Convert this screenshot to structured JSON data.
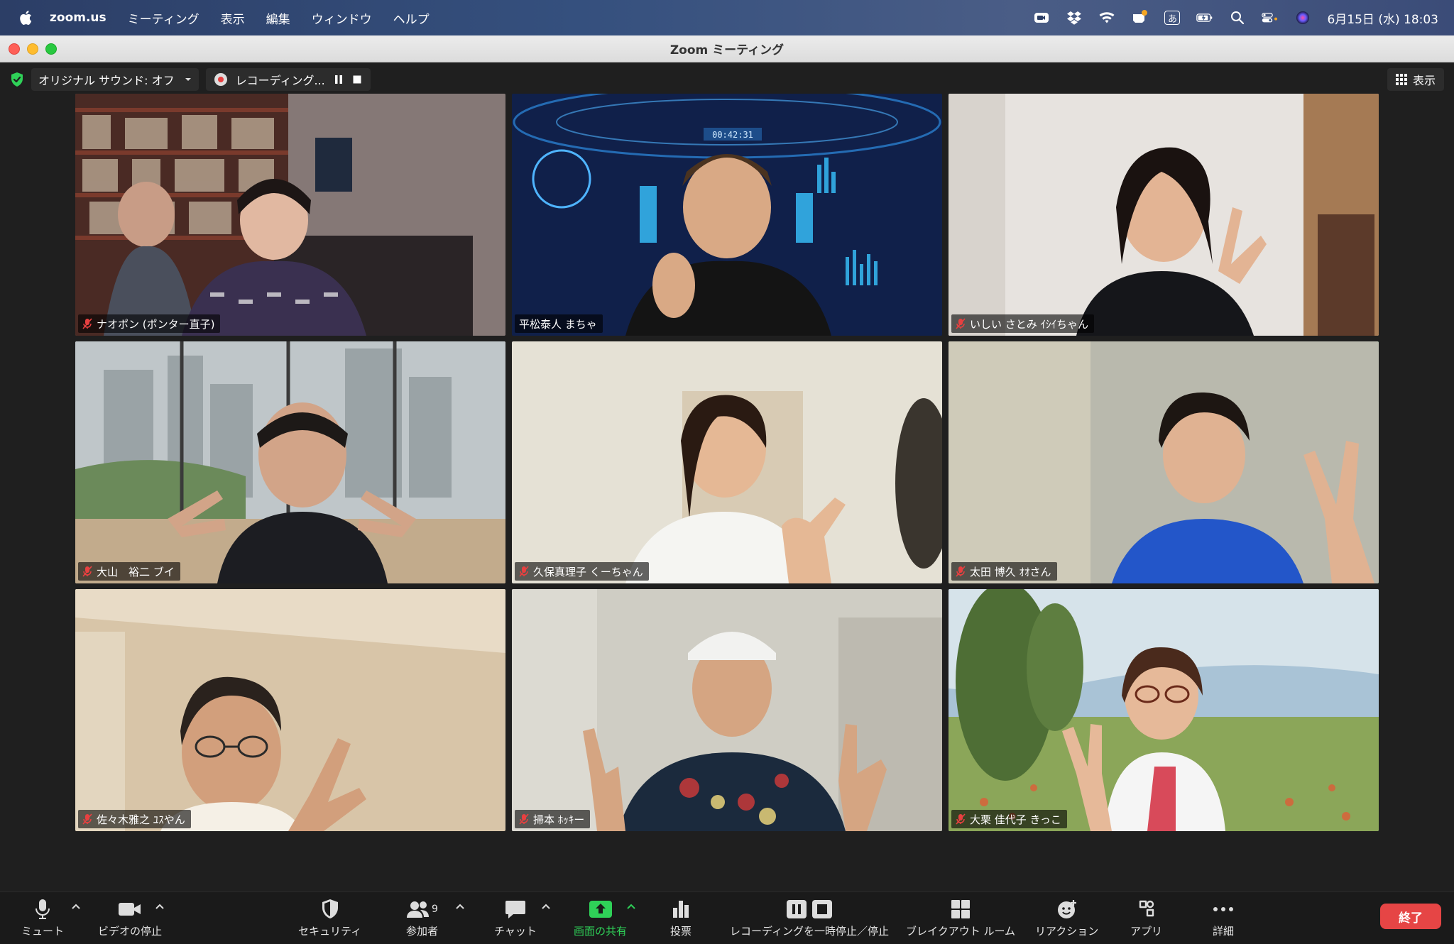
{
  "menubar": {
    "app_name": "zoom.us",
    "items": [
      "ミーティング",
      "表示",
      "編集",
      "ウィンドウ",
      "ヘルプ"
    ],
    "ime_label": "あ",
    "clock": "6月15日 (水)  18:03"
  },
  "window": {
    "title": "Zoom ミーティング"
  },
  "infobar": {
    "audio_label": "オリジナル サウンド: オフ",
    "recording_label": "レコーディング...",
    "view_label": "表示"
  },
  "participants": [
    {
      "name": "ナオポン (ポンター直子)",
      "muted": true
    },
    {
      "name": "平松泰人 まちゃ",
      "muted": false
    },
    {
      "name": "いしい さとみ ｲｼｲちゃん",
      "muted": true
    },
    {
      "name": "大山　裕二 ブイ",
      "muted": true
    },
    {
      "name": "久保真理子 くーちゃん",
      "muted": true
    },
    {
      "name": "太田 博久 ｵｵさん",
      "muted": true
    },
    {
      "name": "佐々木雅之 ﾕｽやん",
      "muted": true
    },
    {
      "name": "掃本 ﾎｯｷー",
      "muted": true
    },
    {
      "name": "大栗 佳代子 きっこ",
      "muted": true
    }
  ],
  "video_overlay": {
    "timer": "00:42:31"
  },
  "toolbar": {
    "mute_label": "ミュート",
    "video_label": "ビデオの停止",
    "security_label": "セキュリティ",
    "participants_label": "参加者",
    "participants_count": "9",
    "chat_label": "チャット",
    "share_label": "画面の共有",
    "poll_label": "投票",
    "recording_label": "レコーディングを一時停止／停止",
    "breakout_label": "ブレイクアウト ルーム",
    "reactions_label": "リアクション",
    "apps_label": "アプリ",
    "more_label": "詳細",
    "end_label": "終了"
  },
  "colors": {
    "active_speaker": "#2fd158",
    "end_button": "#e64545",
    "share_green": "#2fd158"
  }
}
